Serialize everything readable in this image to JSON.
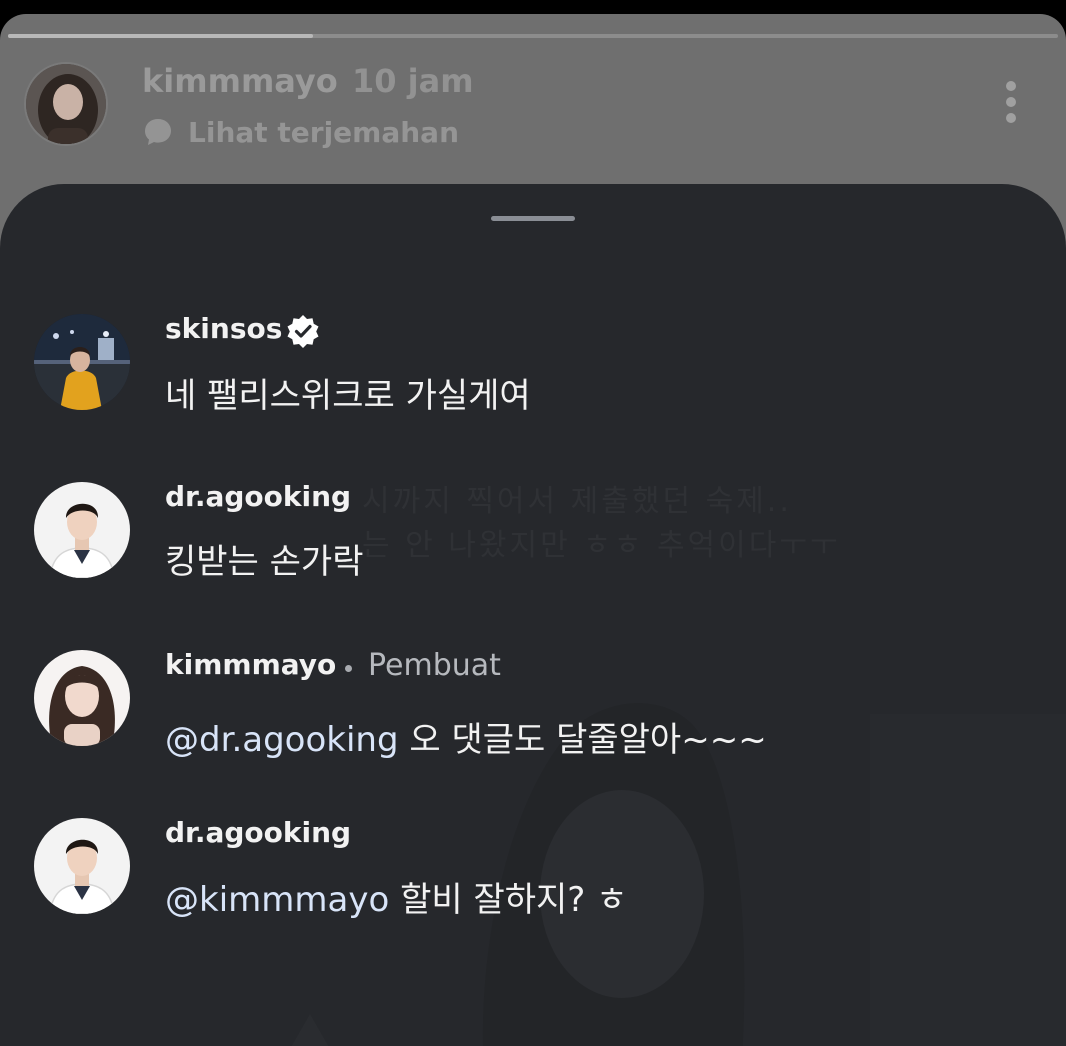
{
  "story": {
    "username": "kimmmayo",
    "time": "10 jam",
    "translate_label": "Lihat terjemahan",
    "progress": 0.29
  },
  "background_caption": {
    "line1": "시까지 찍어서 제출했던 숙제..",
    "line2": "는 안 나왔지만 ㅎㅎ 추억이다ㅜㅜ"
  },
  "comments": [
    {
      "username": "skinsos",
      "verified": true,
      "text": "네 팰리스위크로 가실게여"
    },
    {
      "username": "dr.agooking",
      "text": "킹받는 손가락"
    },
    {
      "username": "kimmmayo",
      "creator_label": "Pembuat",
      "mention": "@dr.agooking",
      "text": "오 댓글도 달줄알아~~~"
    },
    {
      "username": "dr.agooking",
      "mention": "@kimmmayo",
      "text": "할비 잘하지? ㅎ"
    }
  ],
  "colors": {
    "sheet_bg": "#26282c",
    "mention": "#d8e4f8",
    "text": "#f2f2f2"
  }
}
